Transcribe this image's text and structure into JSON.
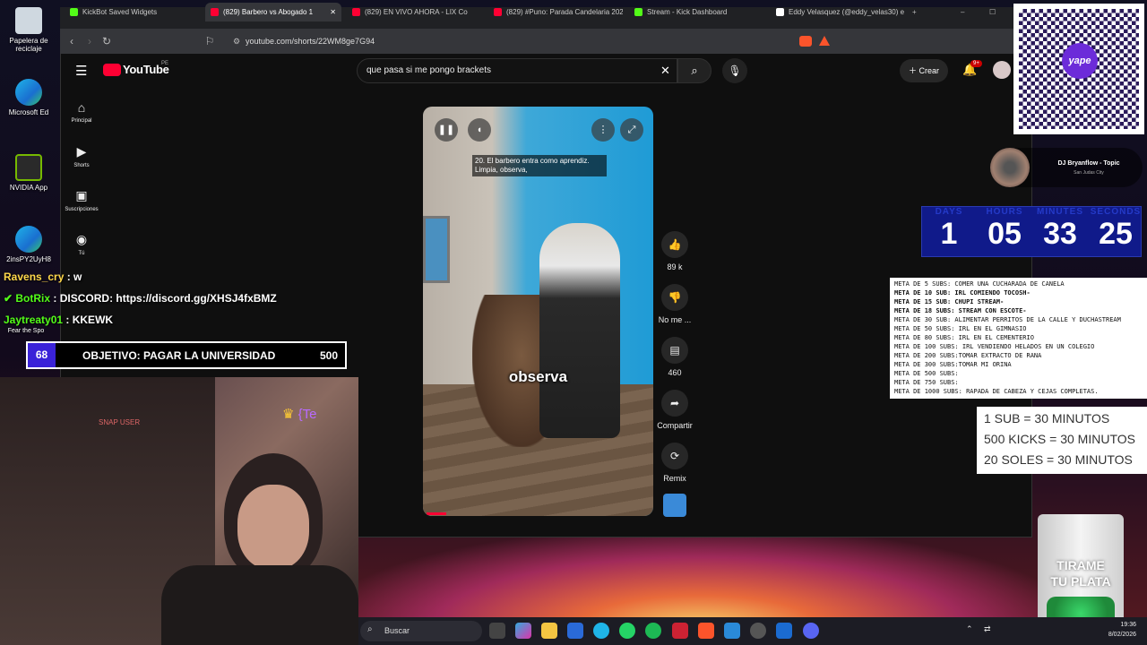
{
  "desktop": {
    "icons": [
      {
        "label": "Papelera de reciclaje"
      },
      {
        "label": "Microsoft Ed"
      },
      {
        "label": "NVIDIA App"
      },
      {
        "label": "2insPY2UyH8"
      },
      {
        "label": "Fear the Spo"
      }
    ]
  },
  "browser": {
    "tabs": [
      {
        "label": "KickBot Saved Widgets",
        "color": "#53fc18"
      },
      {
        "label": "(829) Barbero vs Abogado 1",
        "color": "#ff0033"
      },
      {
        "label": "(829) EN VIVO AHORA - LIX Co",
        "color": "#ff0033"
      },
      {
        "label": "(829) #Puno: Parada Candelaria 202",
        "color": "#ff0033"
      },
      {
        "label": "Stream - Kick Dashboard",
        "color": "#53fc18"
      },
      {
        "label": "Eddy Velasquez (@eddy_velas30) e",
        "color": "#ffffff"
      }
    ],
    "url": "youtube.com/shorts/22WM8ge7G94"
  },
  "youtube": {
    "logo": "YouTube",
    "region": "PE",
    "search_value": "que pasa si me pongo brackets",
    "create_label": "Crear",
    "notif_count": "9+",
    "nav": [
      {
        "label": "Principal",
        "icon": "home-icon"
      },
      {
        "label": "Shorts",
        "icon": "shorts-icon"
      },
      {
        "label": "Suscripciones",
        "icon": "subscriptions-icon"
      },
      {
        "label": "Tú",
        "icon": "you-icon"
      }
    ],
    "short": {
      "caption": "20. El barbero entra como aprendiz. Limpia, observa,",
      "big_caption": "observa",
      "likes": "89 k",
      "dislike_label": "No me ...",
      "comments": "460",
      "share_label": "Compartir",
      "remix_label": "Remix"
    }
  },
  "overlay": {
    "chat": [
      {
        "user": "Ravens_cry",
        "text": " : w",
        "color": "#ffd84a"
      },
      {
        "user": "BotRix",
        "text": " : DISCORD: https://discord.gg/XHSJ4fxBMZ",
        "color": "#53fc18"
      },
      {
        "user": "Jaytreaty01",
        "text": " : KKEWK",
        "color": "#53fc18"
      }
    ],
    "goal": {
      "current": "68",
      "label": "OBJETIVO: PAGAR LA UNIVERSIDAD",
      "target": "500"
    },
    "snap_label": "SNAP USER",
    "cam_text": "{Te",
    "dj": {
      "name": "DJ Bryanflow - Topic",
      "sub": "San Judas City"
    },
    "timer": [
      {
        "label": "DAYS",
        "value": "1"
      },
      {
        "label": "HOURS",
        "value": "05"
      },
      {
        "label": "MINUTES",
        "value": "33"
      },
      {
        "label": "SECONDS",
        "value": "25"
      }
    ],
    "metas": [
      {
        "text": "META DE 5 SUBS: COMER UNA CUCHARADA DE CANELA",
        "bold": false
      },
      {
        "text": "META DE 10 SUB: IRL COMIENDO TOCOSH-",
        "bold": true
      },
      {
        "text": "META DE 15 SUB: CHUPI STREAM-",
        "bold": true
      },
      {
        "text": "META DE 18 SUBS: STREAM CON ESCOTE-",
        "bold": true
      },
      {
        "text": "META DE 30 SUB:  ALIMENTAR PERRITOS DE LA CALLE Y DUCHASTREAM",
        "bold": false
      },
      {
        "text": "META DE 50 SUBS: IRL EN EL GIMNASIO",
        "bold": false
      },
      {
        "text": "META DE 80 SUBS: IRL EN EL CEMENTERIO",
        "bold": false
      },
      {
        "text": "META DE 100 SUBS: IRL VENDIENDO HELADOS EN UN COLEGIO",
        "bold": false
      },
      {
        "text": "META DE 200 SUBS:TOMAR EXTRACTO DE RANA",
        "bold": false
      },
      {
        "text": "META DE 300 SUBS:TOMAR MI ORINA",
        "bold": false
      },
      {
        "text": "META DE 500 SUBS:",
        "bold": false
      },
      {
        "text": "META DE 750 SUBS:",
        "bold": false
      },
      {
        "text": "META DE 1000 SUBS: RAPADA DE CABEZA Y CEJAS COMPLETAS.",
        "bold": false
      }
    ],
    "subs_rates": [
      "1 SUB = 30 MINUTOS",
      "500 KICKS = 30 MINUTOS",
      "20 SOLES = 30 MINUTOS"
    ],
    "jar_text": [
      "TIRAME",
      "TU PLATA"
    ],
    "qr_logo": "yape"
  },
  "taskbar": {
    "search_placeholder": "Buscar",
    "time": "19:36",
    "date": "8/02/2026"
  }
}
